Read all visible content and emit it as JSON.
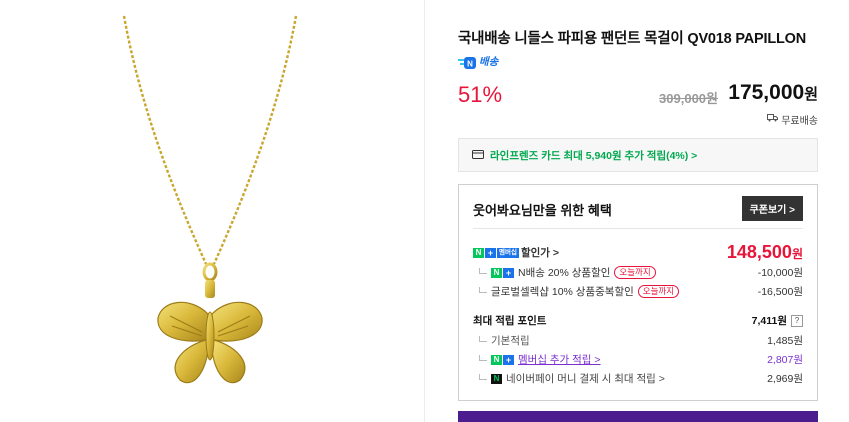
{
  "product": {
    "title": "국내배송 니들스 파피용 팬던트 목걸이 QV018 PAPILLON",
    "delivery_badge": "배송",
    "discount": "51%",
    "original_price": "309,000원",
    "sale_price": "175,000",
    "sale_unit": "원",
    "shipping": "무료배송"
  },
  "card_promo": "라인프렌즈 카드 최대 5,940원 추가 적립(4%) >",
  "benefit": {
    "heading": "웃어봐요님만을 위한 혜택",
    "coupon_button": "쿠폰보기 >",
    "member_badge": "멤버십",
    "member_price_label": "할인가 >",
    "member_price": "148,500",
    "member_price_unit": "원",
    "discounts": [
      {
        "label": "N배송 20% 상품할인",
        "pill": "오늘까지",
        "value": "-10,000원"
      },
      {
        "label": "글로벌셀렉샵 10% 상품중복할인",
        "pill": "오늘까지",
        "value": "-16,500원"
      }
    ],
    "points_label": "최대 적립 포인트",
    "points_value": "7,411원",
    "points_help": "?",
    "points": [
      {
        "label": "기본적립",
        "value": "1,485원"
      },
      {
        "label": "멤버십 추가 적립 >",
        "value": "2,807원"
      },
      {
        "label": "네이버페이 머니 결제 시 최대 적립 >",
        "value": "2,969원"
      }
    ]
  },
  "colors": {
    "accent_red": "#e8153a",
    "naver_green": "#03c75a",
    "membership_purple": "#7b2fcf",
    "card_green": "#00a84f"
  }
}
